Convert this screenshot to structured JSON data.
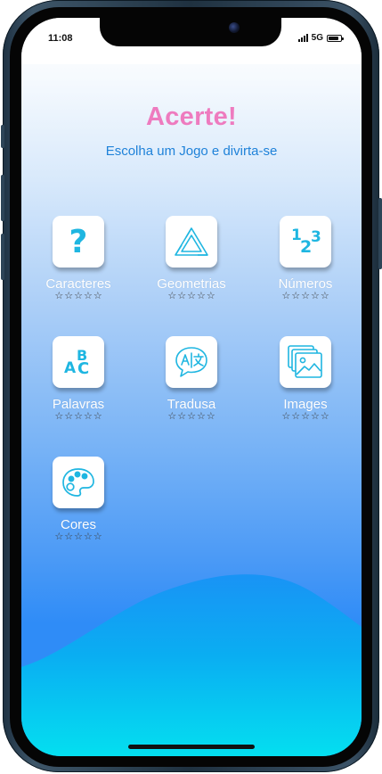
{
  "status": {
    "time": "11:08",
    "network": "5G"
  },
  "app": {
    "title": "Acerte!",
    "subtitle": "Escolha um Jogo e divirta-se"
  },
  "games": [
    {
      "label": "Caracteres",
      "icon": "question-mark-icon",
      "rating": 0,
      "max_rating": 5
    },
    {
      "label": "Geometrias",
      "icon": "impossible-triangle-icon",
      "rating": 0,
      "max_rating": 5
    },
    {
      "label": "Números",
      "icon": "numbers-123-icon",
      "rating": 0,
      "max_rating": 5
    },
    {
      "label": "Palavras",
      "icon": "letters-abc-icon",
      "rating": 0,
      "max_rating": 5
    },
    {
      "label": "Tradusa",
      "icon": "translate-icon",
      "rating": 0,
      "max_rating": 5
    },
    {
      "label": "Images",
      "icon": "image-gallery-icon",
      "rating": 0,
      "max_rating": 5
    },
    {
      "label": "Cores",
      "icon": "palette-icon",
      "rating": 0,
      "max_rating": 5
    }
  ],
  "icon_glyphs": {
    "question": "?",
    "numbers": [
      "1",
      "2",
      "3"
    ],
    "letters": [
      "A",
      "B",
      "C"
    ]
  },
  "colors": {
    "title": "#ee7bbf",
    "subtitle": "#1f82d9",
    "icon": "#1fb6e1",
    "wave_top": "#1993f5",
    "wave_bottom": "#04dff0"
  }
}
